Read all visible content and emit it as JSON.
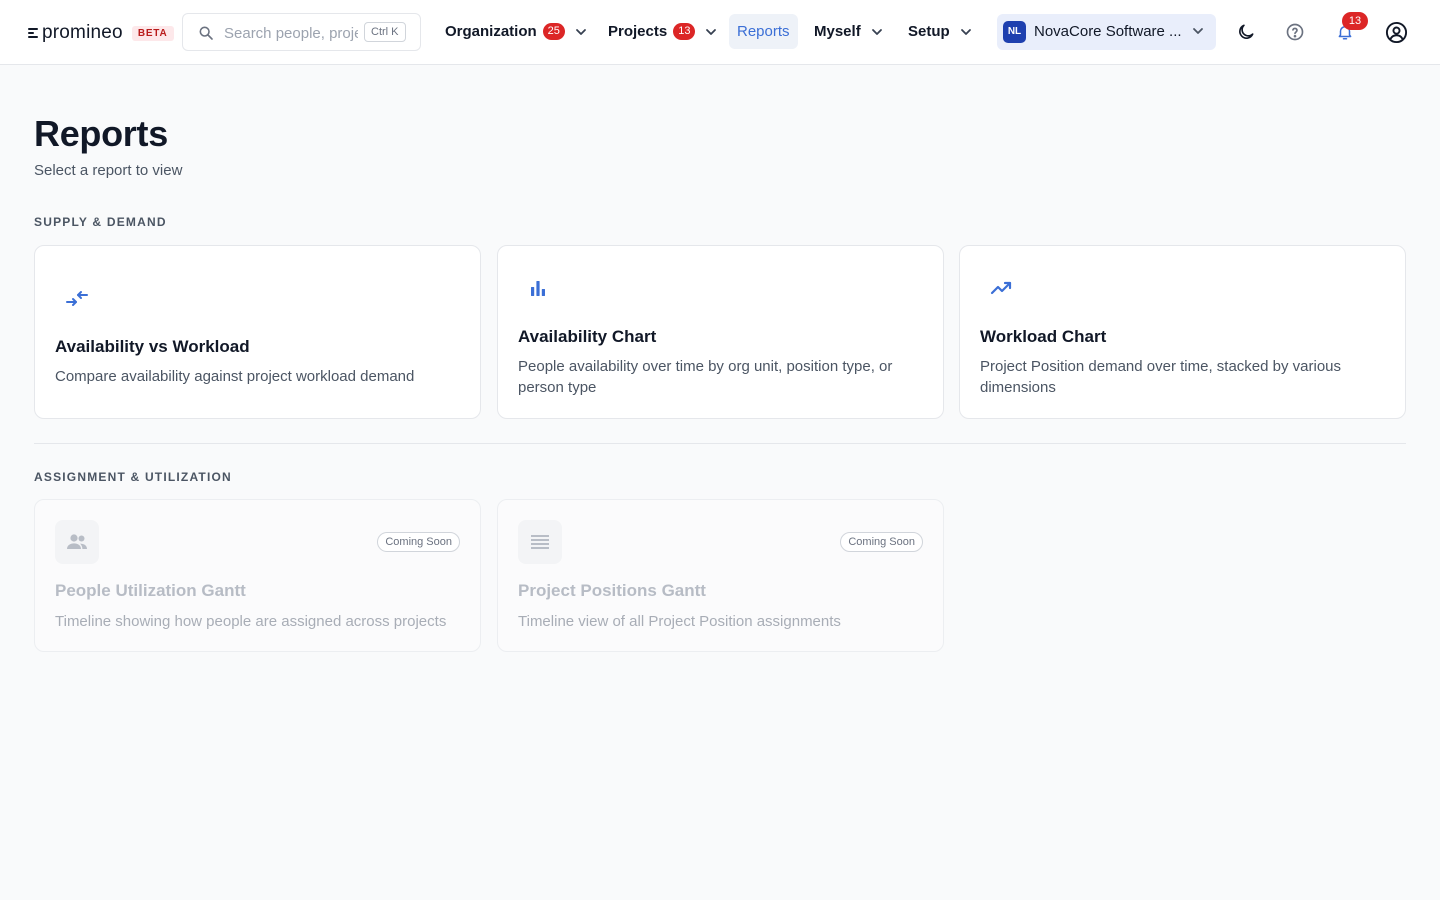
{
  "header": {
    "logo_text": "promineo",
    "beta_label": "BETA",
    "search": {
      "placeholder": "Search people, projects...",
      "value": "",
      "shortcut": "Ctrl K"
    },
    "nav": [
      {
        "label": "Organization",
        "badge": "25",
        "has_dropdown": true
      },
      {
        "label": "Projects",
        "badge": "13",
        "has_dropdown": true
      },
      {
        "label": "Reports",
        "active": true
      },
      {
        "label": "Myself",
        "has_dropdown": true
      },
      {
        "label": "Setup",
        "has_dropdown": true
      }
    ],
    "org": {
      "initials": "NL",
      "name": "NovaCore Software ..."
    },
    "notifications_count": "13",
    "icons": [
      "moon-icon",
      "help-icon",
      "bell-icon",
      "user-circle-icon"
    ]
  },
  "page": {
    "title": "Reports",
    "subtitle": "Select a report to view"
  },
  "sections": [
    {
      "title": "SUPPLY & DEMAND",
      "cards": [
        {
          "title": "Availability vs Workload",
          "description": "Compare availability against project workload demand",
          "icon": "compare-arrows-icon"
        },
        {
          "title": "Availability Chart",
          "description": "People availability over time by org unit, position type, or person type",
          "icon": "bar-chart-icon"
        },
        {
          "title": "Workload Chart",
          "description": "Project Position demand over time, stacked by various dimensions",
          "icon": "trending-up-icon"
        }
      ]
    },
    {
      "title": "ASSIGNMENT & UTILIZATION",
      "cards": [
        {
          "title": "People Utilization Gantt",
          "description": "Timeline showing how people are assigned across projects",
          "icon": "people-icon",
          "badge": "Coming Soon"
        },
        {
          "title": "Project Positions Gantt",
          "description": "Timeline view of all Project Position assignments",
          "icon": "list-icon",
          "badge": "Coming Soon"
        }
      ]
    }
  ],
  "colors": {
    "accent": "#3b6fd6",
    "badge_red": "#dc2626",
    "org_avatar": "#1e40af",
    "background": "#f9fafb"
  }
}
